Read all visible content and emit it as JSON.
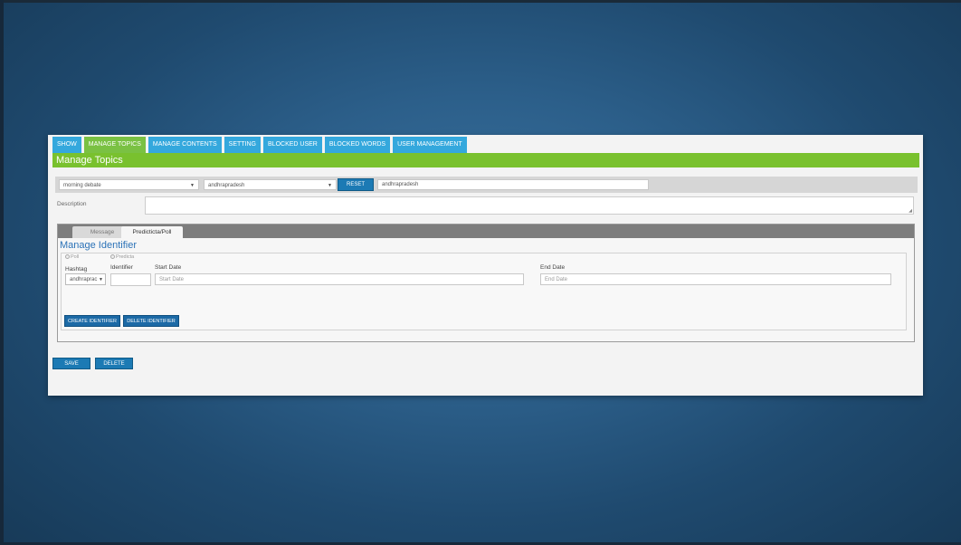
{
  "tabs": [
    {
      "label": "SHOW",
      "active": false
    },
    {
      "label": "MANAGE TOPICS",
      "active": true
    },
    {
      "label": "MANAGE CONTENTS",
      "active": false
    },
    {
      "label": "SETTING",
      "active": false
    },
    {
      "label": "BLOCKED USER",
      "active": false
    },
    {
      "label": "BLOCKED WORDS",
      "active": false
    },
    {
      "label": "USER MANAGEMENT",
      "active": false
    }
  ],
  "section_title": "Manage Topics",
  "filters": {
    "topic_select": "morning debate",
    "region_select": "andhrapradesh",
    "reset_label": "RESET",
    "text_value": "andhrapradesh"
  },
  "description": {
    "label": "Description",
    "value": ""
  },
  "inner_tabs": [
    {
      "label": "Message",
      "active": false
    },
    {
      "label": "Predicticta/Poll",
      "active": true
    }
  ],
  "identifier": {
    "title": "Manage Identifier",
    "radio_poll": "Poll",
    "radio_predicta": "Predicta",
    "hashtag_label": "Hashtag",
    "identifier_label": "Identifier",
    "start_date_label": "Start Date",
    "end_date_label": "End Date",
    "hashtag_value": "andhraprac",
    "start_date_placeholder": "Start Date",
    "end_date_placeholder": "End Date",
    "create_label": "CREATE IDENTIFIER",
    "delete_label": "DELETE IDENTIFIER"
  },
  "actions": {
    "save_label": "SAVE",
    "delete_label": "DELETE"
  },
  "colors": {
    "tab_blue": "#34a8dd",
    "tab_green": "#7ac143",
    "button_blue": "#1c7ab4",
    "title_blue": "#2b72b7"
  }
}
